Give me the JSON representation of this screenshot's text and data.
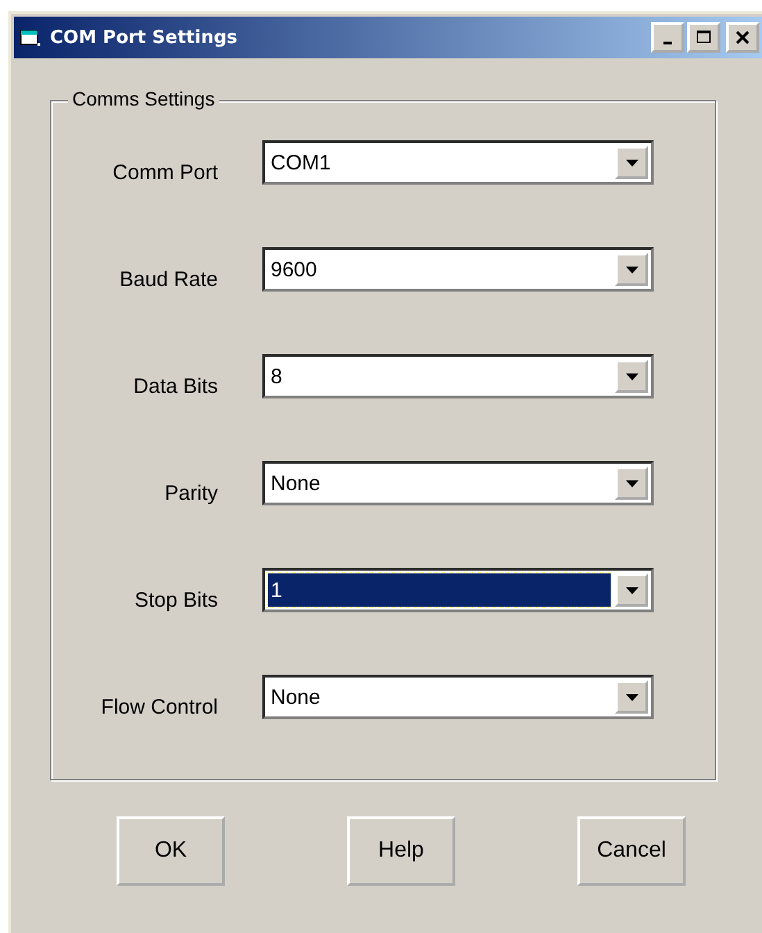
{
  "window": {
    "title": "COM Port Settings"
  },
  "group": {
    "title": "Comms Settings"
  },
  "fields": [
    {
      "label": "Comm Port",
      "value": "COM1",
      "focused": false
    },
    {
      "label": "Baud Rate",
      "value": "9600",
      "focused": false
    },
    {
      "label": "Data Bits",
      "value": "8",
      "focused": false
    },
    {
      "label": "Parity",
      "value": "None",
      "focused": false
    },
    {
      "label": "Stop Bits",
      "value": "1",
      "focused": true
    },
    {
      "label": "Flow Control",
      "value": "None",
      "focused": false
    }
  ],
  "buttons": [
    "OK",
    "Help",
    "Cancel"
  ]
}
